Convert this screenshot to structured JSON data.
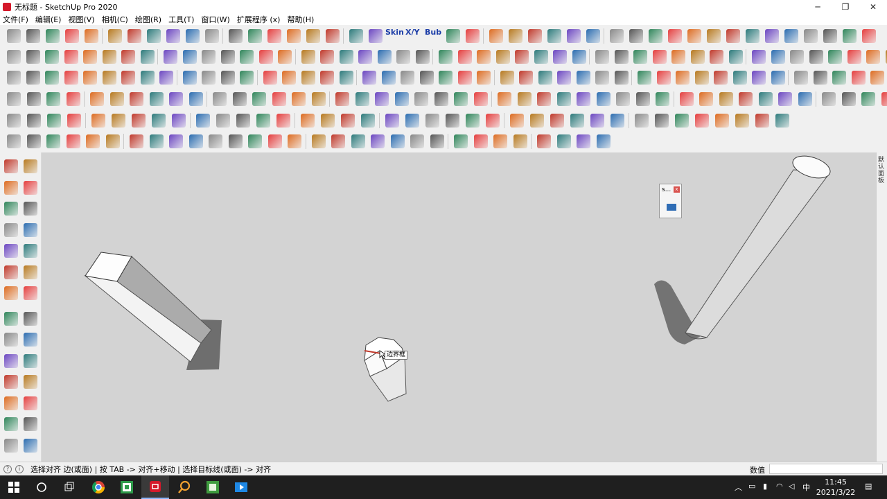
{
  "window": {
    "title": "无标题 - SketchUp Pro 2020",
    "minimize_glyph": "─",
    "maximize_glyph": "❐",
    "close_glyph": "✕"
  },
  "menu": {
    "items": [
      "文件(F)",
      "编辑(E)",
      "视图(V)",
      "相机(C)",
      "绘图(R)",
      "工具(T)",
      "窗口(W)",
      "扩展程序 (x)",
      "帮助(H)"
    ]
  },
  "toolbar": {
    "skin_label": "Skin",
    "xy_label": "X/Y",
    "bub_label": "Bub"
  },
  "viewport": {
    "background_color": "#d3d3d3",
    "tooltip_label": "边界框",
    "popup_title": "s...",
    "popup_close": "x",
    "tray_label": "默认面板"
  },
  "status": {
    "help_text": "选择对齐 边(或面) | 按 TAB -> 对齐+移动 | 选择目标线(或面) -> 对齐",
    "info_glyph": "i",
    "geo_glyph": "?",
    "measurements_label": "数值",
    "measurements_value": ""
  },
  "taskbar": {
    "time": "11:45",
    "date": "2021/3/22",
    "ime": "中",
    "icons": [
      "windows-start-icon",
      "search-icon",
      "task-view-icon",
      "chrome-icon",
      "camtasia-icon",
      "sketchup-icon",
      "search-tool-icon",
      "green-app-icon",
      "media-app-icon"
    ]
  },
  "colors": {
    "accent_red": "#d4192b",
    "accent_blue": "#1d3ea8",
    "taskbar": "#1f1f1f"
  }
}
